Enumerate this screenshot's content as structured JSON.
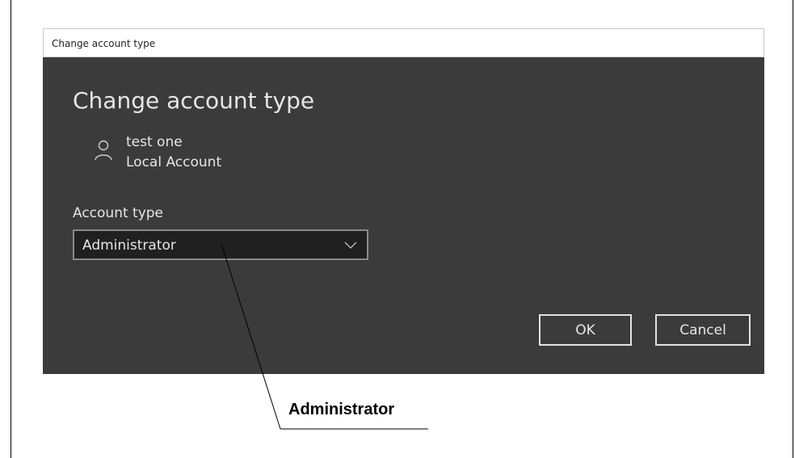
{
  "dialog": {
    "window_title": "Change account type",
    "heading": "Change account type",
    "user": {
      "icon": "person-icon",
      "name": "test one",
      "account_kind": "Local Account"
    },
    "account_type": {
      "label": "Account type",
      "selected": "Administrator"
    },
    "buttons": {
      "ok": "OK",
      "cancel": "Cancel"
    },
    "colors": {
      "background": "#3b3b3b",
      "select_background": "#202020",
      "text": "#e6e6e6"
    }
  },
  "callout": {
    "label": "Administrator"
  }
}
